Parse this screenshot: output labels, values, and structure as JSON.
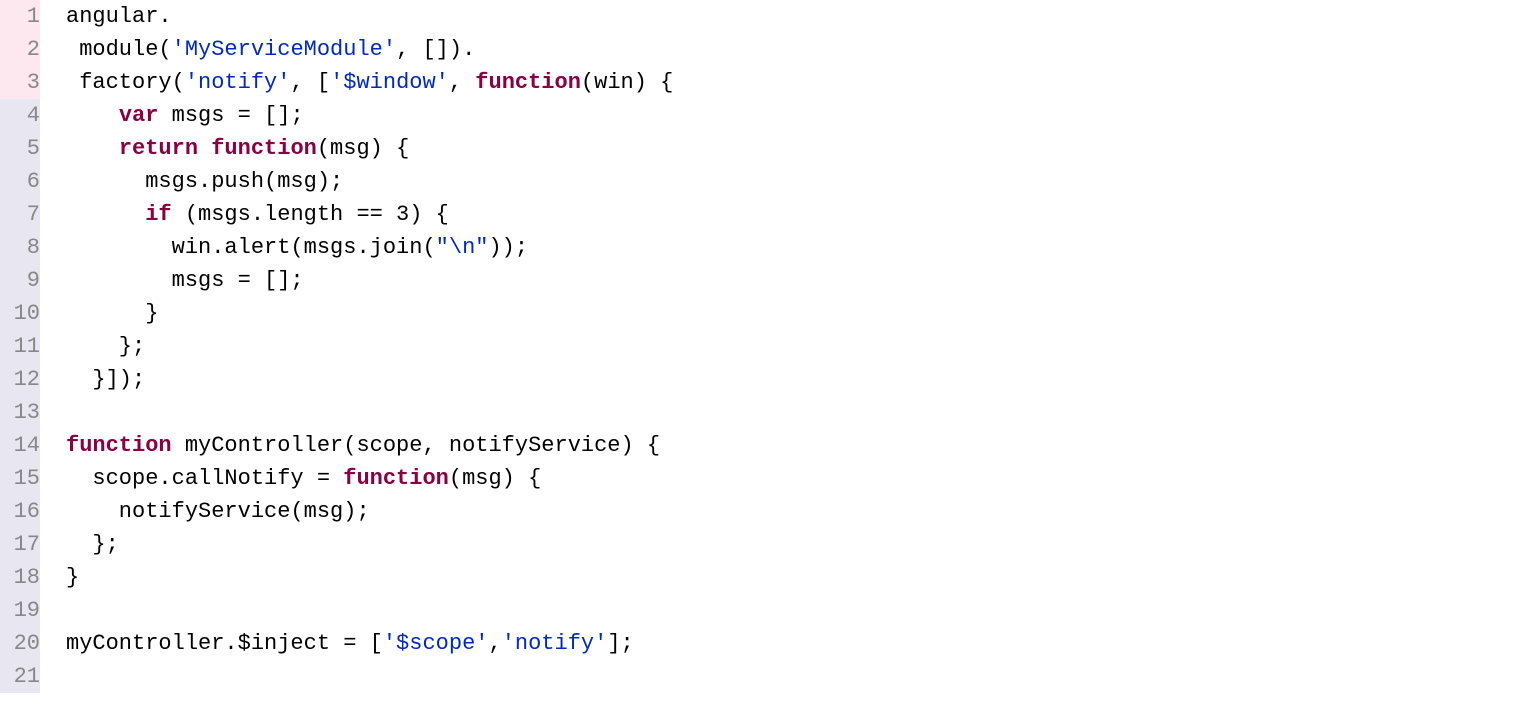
{
  "code": {
    "lines": [
      {
        "num": 1,
        "highlight": "highlighted",
        "tokens": [
          {
            "text": "angular.",
            "class": "tok-default"
          }
        ]
      },
      {
        "num": 2,
        "highlight": "highlighted",
        "tokens": [
          {
            "text": " module(",
            "class": "tok-default"
          },
          {
            "text": "'MyServiceModule'",
            "class": "tok-string"
          },
          {
            "text": ", []).",
            "class": "tok-default"
          }
        ]
      },
      {
        "num": 3,
        "highlight": "highlighted",
        "tokens": [
          {
            "text": " factory(",
            "class": "tok-default"
          },
          {
            "text": "'notify'",
            "class": "tok-string"
          },
          {
            "text": ", [",
            "class": "tok-default"
          },
          {
            "text": "'$window'",
            "class": "tok-string"
          },
          {
            "text": ", ",
            "class": "tok-default"
          },
          {
            "text": "function",
            "class": "tok-keyword"
          },
          {
            "text": "(win) {",
            "class": "tok-default"
          }
        ]
      },
      {
        "num": 4,
        "highlight": "dimmed",
        "tokens": [
          {
            "text": "    ",
            "class": "tok-default"
          },
          {
            "text": "var",
            "class": "tok-keyword"
          },
          {
            "text": " msgs = [];",
            "class": "tok-default"
          }
        ]
      },
      {
        "num": 5,
        "highlight": "dimmed",
        "tokens": [
          {
            "text": "    ",
            "class": "tok-default"
          },
          {
            "text": "return",
            "class": "tok-keyword"
          },
          {
            "text": " ",
            "class": "tok-default"
          },
          {
            "text": "function",
            "class": "tok-keyword"
          },
          {
            "text": "(msg) {",
            "class": "tok-default"
          }
        ]
      },
      {
        "num": 6,
        "highlight": "dimmed",
        "tokens": [
          {
            "text": "      msgs.push(msg);",
            "class": "tok-default"
          }
        ]
      },
      {
        "num": 7,
        "highlight": "dimmed",
        "tokens": [
          {
            "text": "      ",
            "class": "tok-default"
          },
          {
            "text": "if",
            "class": "tok-keyword"
          },
          {
            "text": " (msgs.length == 3) {",
            "class": "tok-default"
          }
        ]
      },
      {
        "num": 8,
        "highlight": "dimmed",
        "tokens": [
          {
            "text": "        win.alert(msgs.join(",
            "class": "tok-default"
          },
          {
            "text": "\"\\n\"",
            "class": "tok-string"
          },
          {
            "text": "));",
            "class": "tok-default"
          }
        ]
      },
      {
        "num": 9,
        "highlight": "dimmed",
        "tokens": [
          {
            "text": "        msgs = [];",
            "class": "tok-default"
          }
        ]
      },
      {
        "num": 10,
        "highlight": "dimmed",
        "tokens": [
          {
            "text": "      }",
            "class": "tok-default"
          }
        ]
      },
      {
        "num": 11,
        "highlight": "dimmed",
        "tokens": [
          {
            "text": "    };",
            "class": "tok-default"
          }
        ]
      },
      {
        "num": 12,
        "highlight": "dimmed",
        "tokens": [
          {
            "text": "  }]);",
            "class": "tok-default"
          }
        ]
      },
      {
        "num": 13,
        "highlight": "dimmed",
        "tokens": []
      },
      {
        "num": 14,
        "highlight": "dimmed",
        "tokens": [
          {
            "text": "function",
            "class": "tok-keyword"
          },
          {
            "text": " myController(scope, notifyService) {",
            "class": "tok-default"
          }
        ]
      },
      {
        "num": 15,
        "highlight": "dimmed",
        "tokens": [
          {
            "text": "  scope.callNotify = ",
            "class": "tok-default"
          },
          {
            "text": "function",
            "class": "tok-keyword"
          },
          {
            "text": "(msg) {",
            "class": "tok-default"
          }
        ]
      },
      {
        "num": 16,
        "highlight": "dimmed",
        "tokens": [
          {
            "text": "    notifyService(msg);",
            "class": "tok-default"
          }
        ]
      },
      {
        "num": 17,
        "highlight": "dimmed",
        "tokens": [
          {
            "text": "  };",
            "class": "tok-default"
          }
        ]
      },
      {
        "num": 18,
        "highlight": "dimmed",
        "tokens": [
          {
            "text": "}",
            "class": "tok-default"
          }
        ]
      },
      {
        "num": 19,
        "highlight": "dimmed",
        "tokens": []
      },
      {
        "num": 20,
        "highlight": "dimmed",
        "tokens": [
          {
            "text": "myController.$inject = [",
            "class": "tok-default"
          },
          {
            "text": "'$scope'",
            "class": "tok-string"
          },
          {
            "text": ",",
            "class": "tok-default"
          },
          {
            "text": "'notify'",
            "class": "tok-string"
          },
          {
            "text": "];",
            "class": "tok-default"
          }
        ]
      },
      {
        "num": 21,
        "highlight": "dimmed",
        "tokens": []
      }
    ]
  }
}
